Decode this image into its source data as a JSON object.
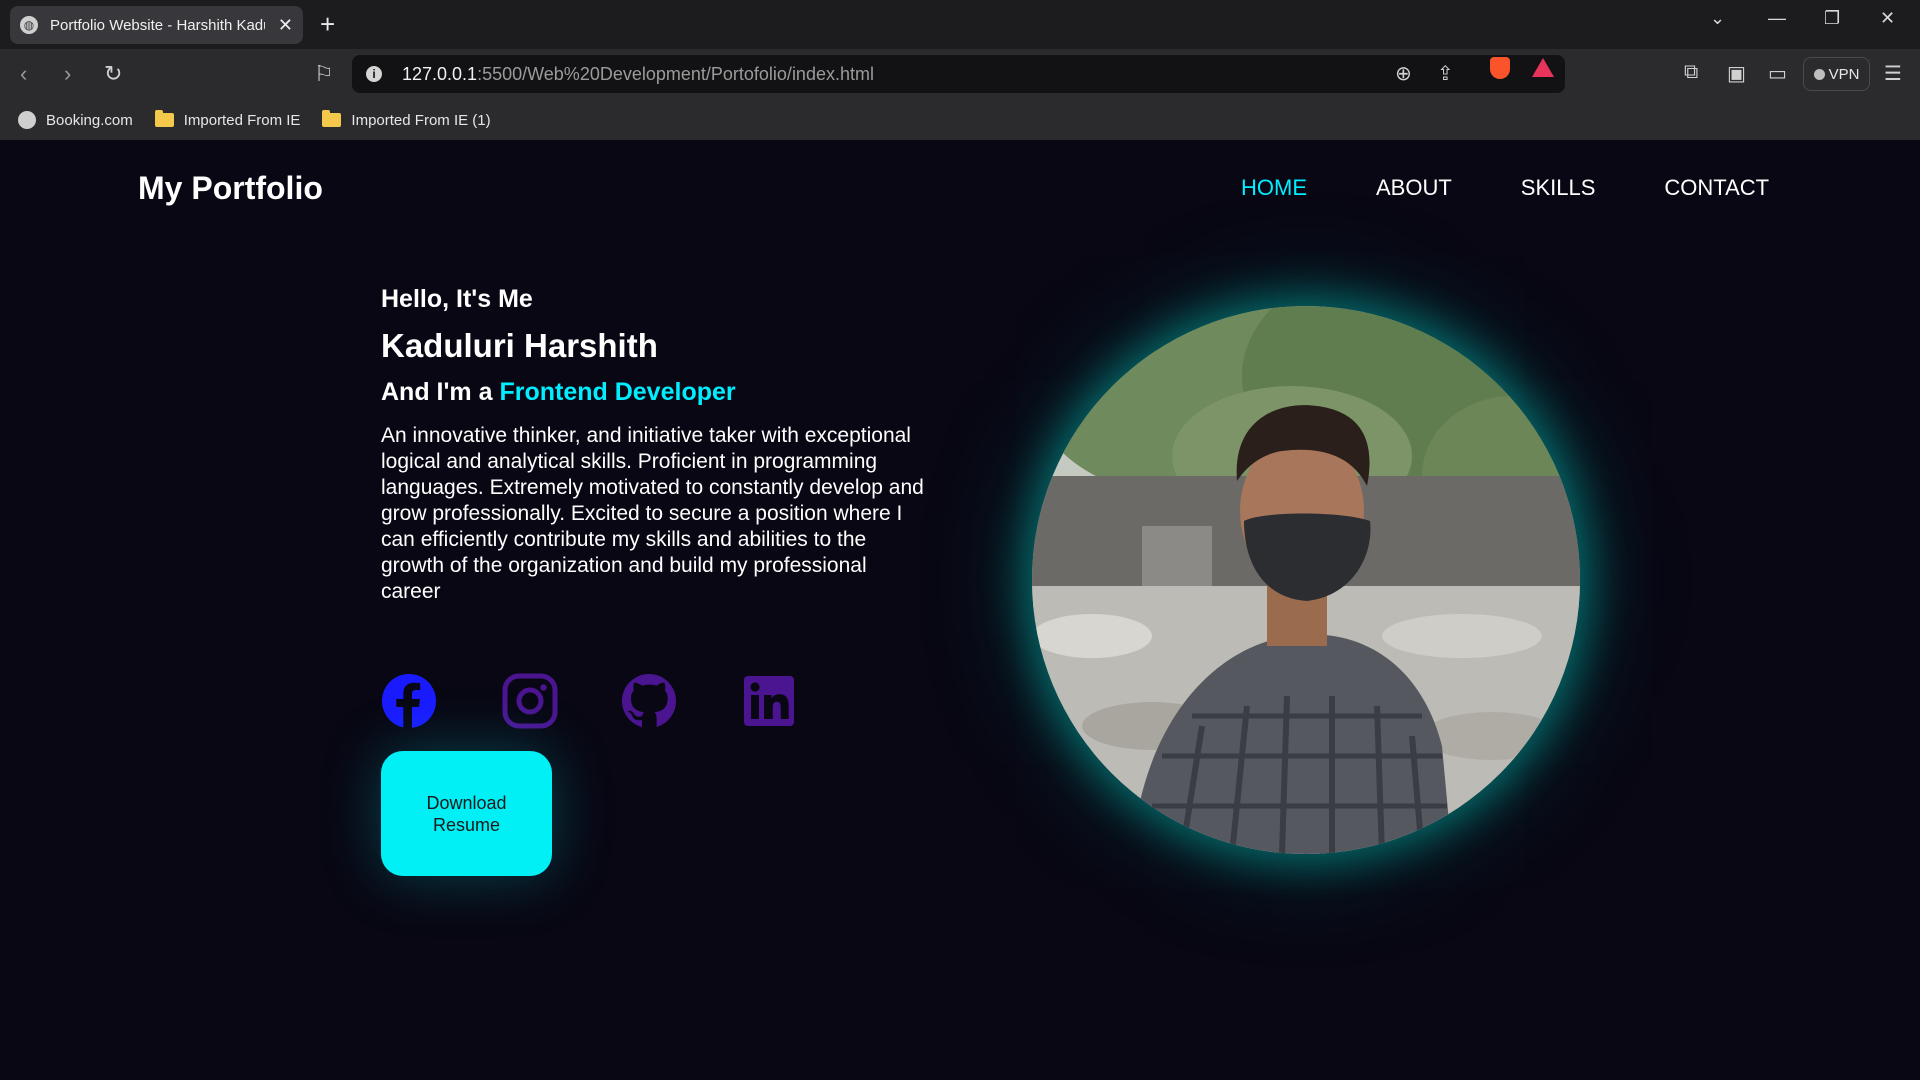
{
  "browser": {
    "tab_title": "Portfolio Website - Harshith Kaduluri",
    "url_host": "127.0.0.1",
    "url_path": ":5500/Web%20Development/Portofolio/index.html",
    "vpn_label": "VPN",
    "bookmarks": [
      {
        "label": "Booking.com",
        "icon": "globe-icon"
      },
      {
        "label": "Imported From IE",
        "icon": "folder-icon"
      },
      {
        "label": "Imported From IE (1)",
        "icon": "folder-icon"
      }
    ]
  },
  "site": {
    "logo": "My Portfolio",
    "nav": [
      {
        "label": "HOME",
        "active": true
      },
      {
        "label": "ABOUT",
        "active": false
      },
      {
        "label": "SKILLS",
        "active": false
      },
      {
        "label": "CONTACT",
        "active": false
      }
    ],
    "hero": {
      "greeting": "Hello, It's Me",
      "name": "Kaduluri Harshith",
      "role_prefix": "And I'm a ",
      "role": "Frontend Developer",
      "bio": "An innovative thinker, and initiative taker with exceptional logical and analytical skills. Proficient in programming languages. Extremely motivated to constantly develop and grow professionally. Excited to secure a position where I can efficiently contribute my skills and abilities to the growth of the organization and build my professional career"
    },
    "socials": [
      {
        "icon": "facebook-icon",
        "color": "#1a1aff"
      },
      {
        "icon": "instagram-icon",
        "color": "#4b1592"
      },
      {
        "icon": "github-icon",
        "color": "#4b1592"
      },
      {
        "icon": "linkedin-icon",
        "color": "#4b1592"
      }
    ],
    "download_label": "Download Resume",
    "accent_color": "#00eeff"
  }
}
